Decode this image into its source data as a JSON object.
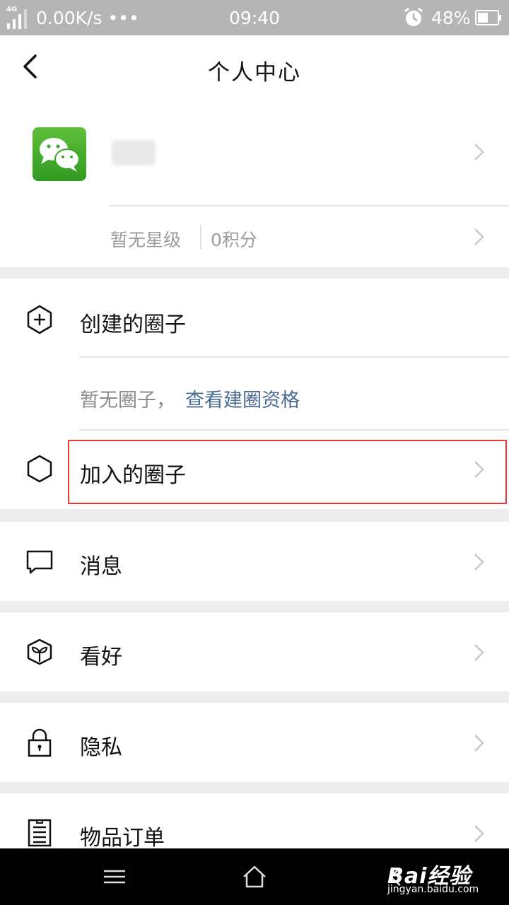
{
  "status_bar": {
    "network_type": "4G",
    "net_speed": "0.00K/s",
    "more": "•••",
    "time": "09:40",
    "battery_percent": "48%"
  },
  "header": {
    "title": "个人中心"
  },
  "profile": {
    "rating": "暂无星级",
    "points": "0积分"
  },
  "circles": {
    "created_label": "创建的圈子",
    "empty_text": "暂无圈子，",
    "qualification_link": "查看建圈资格",
    "joined_label": "加入的圈子"
  },
  "menu": {
    "messages": "消息",
    "favorites": "看好",
    "privacy": "隐私",
    "orders": "物品订单"
  },
  "watermark": {
    "logo": "Bai经验",
    "url": "jingyan.baidu.com"
  },
  "colors": {
    "link": "#4a6b92",
    "highlight_border": "#e53935",
    "status_bar": "#b5b5b5"
  }
}
